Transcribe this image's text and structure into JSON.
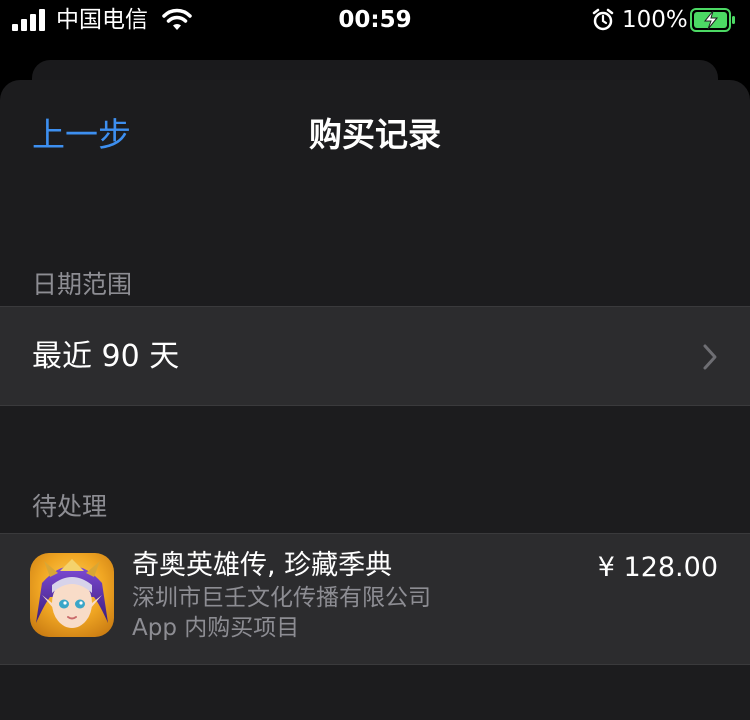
{
  "status_bar": {
    "carrier": "中国电信",
    "time": "00:59",
    "battery_percent": "100%",
    "icons": [
      "signal-icon",
      "wifi-icon",
      "alarm-icon",
      "battery-charging-icon"
    ]
  },
  "nav": {
    "back_label": "上一步",
    "title": "购买记录"
  },
  "date_range": {
    "header": "日期范围",
    "value": "最近 90 天",
    "icon": "chevron-right-icon"
  },
  "pending": {
    "header": "待处理",
    "item": {
      "name": "奇奥英雄传, 珍藏季典",
      "developer": "深圳市巨壬文化传播有限公司",
      "type": "App 内购买项目",
      "price": "¥ 128.00",
      "icon": "game-app-icon"
    }
  },
  "colors": {
    "accent": "#3d8ff0",
    "background": "#1c1c1e",
    "row": "#2c2c2e",
    "secondary_text": "#8d8d93",
    "battery_green": "#4cd964"
  }
}
